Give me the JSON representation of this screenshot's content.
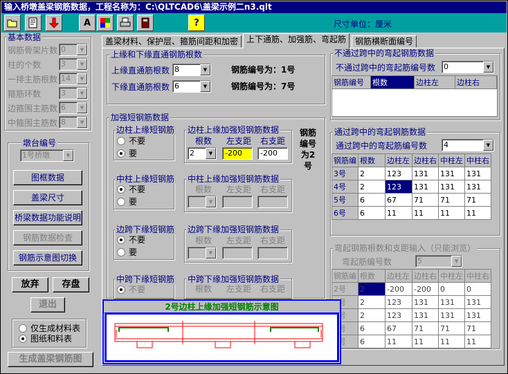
{
  "window": {
    "title": "输入桥墩盖梁钢筋数据，工程名称为：C:\\QLTCAD6\\盖梁示例二n3.qlt"
  },
  "toolbar": {
    "unit_label": "尺寸单位：厘米",
    "buttons": [
      "folder-open-icon",
      "edit-icon",
      "arrow-down-icon",
      "text-icon",
      "color-icon",
      "print-icon",
      "calculator-icon",
      "help-icon"
    ],
    "text_glyph": "A",
    "help_glyph": "?"
  },
  "left": {
    "basic_title": "基本数据",
    "basic_fields": [
      {
        "label": "钢筋骨架片数",
        "value": "0"
      },
      {
        "label": "柱的个数",
        "value": "3"
      },
      {
        "label": "一排主筋根数",
        "value": "14"
      },
      {
        "label": "箍筋环数",
        "value": "3"
      },
      {
        "label": "边箍围主筋数",
        "value": "6"
      },
      {
        "label": "中箍围主筋数",
        "value": "8"
      }
    ],
    "pier_title": "墩台编号",
    "pier_value": "1号桥墩",
    "buttons": [
      "图框数据",
      "盖梁尺寸",
      "桥梁数据功能说明",
      "钢筋数据检查",
      "钢筋示意图切换"
    ],
    "abandon": "放弃",
    "save": "存盘",
    "exit": "退出",
    "output_options": [
      "仅生成材料表",
      "图纸和料表"
    ],
    "generate": "生成盖梁钢筋图"
  },
  "tabs": [
    "盖梁材料、保护层、箍筋间距和加密",
    "上下通筋、加强筋、弯起筋",
    "钢筋横断面编号"
  ],
  "through": {
    "title": "上缘和下缘直通钢筋根数",
    "top_label": "上缘直通筋根数",
    "top_value": "8",
    "top_code": "钢筋编号为：1号",
    "bottom_label": "下缘直通筋根数",
    "bottom_value": "6",
    "bottom_code": "钢筋编号为：7号"
  },
  "reinforce": {
    "title": "加强短钢筋数据",
    "side_code": "钢筋编号为2号",
    "groups": [
      {
        "title": "边柱上缘短钢筋",
        "no": "不要",
        "yes": "要",
        "sel": "yes",
        "data_title": "边柱上缘加强短钢筋数据",
        "count": "2",
        "left": "-200",
        "right": "-200"
      },
      {
        "title": "中柱上缘短钢筋",
        "no": "不要",
        "yes": "要",
        "sel": "no",
        "data_title": "中柱上缘加强短钢筋数据",
        "count": "",
        "left": "",
        "right": ""
      },
      {
        "title": "边跨下缘短钢筋",
        "no": "不要",
        "yes": "要",
        "sel": "no",
        "data_title": "边跨下缘加强短钢筋数据",
        "count": "",
        "left": "",
        "right": ""
      },
      {
        "title": "中跨下缘短钢筋",
        "no": "不要",
        "yes": "要",
        "sel": "no",
        "data_title": "中跨下缘加强短钢筋数据",
        "count": "",
        "left": "",
        "right": ""
      }
    ],
    "col_count": "根数",
    "col_left": "左支距",
    "col_right": "右支距"
  },
  "no_span_bent": {
    "title": "不通过跨中的弯起钢筋数据",
    "count_label": "不通过跨中的弯起筋编号数",
    "count_value": "0",
    "headers": [
      "钢筋编号",
      "根数",
      "边柱左",
      "边柱右"
    ]
  },
  "span_bent": {
    "title": "通过跨中的弯起钢筋数据",
    "count_label": "通过跨中的弯起筋编号数",
    "count_value": "4",
    "headers": [
      "钢筋编",
      "根数",
      "边柱左",
      "边柱右",
      "中柱左",
      "中柱右"
    ],
    "rows": [
      [
        "3号",
        "2",
        "123",
        "131",
        "131",
        "131"
      ],
      [
        "4号",
        "2",
        "123",
        "131",
        "131",
        "131"
      ],
      [
        "5号",
        "6",
        "67",
        "71",
        "71",
        "71"
      ],
      [
        "6号",
        "6",
        "11",
        "11",
        "11",
        "11"
      ]
    ]
  },
  "bent_view": {
    "title": "弯起钢筋根数和支距输入（只能浏览）",
    "count_label": "弯起筋编号数",
    "count_value": "5",
    "headers": [
      "钢筋编",
      "根数",
      "边柱左",
      "边柱右",
      "中柱左",
      "中柱右"
    ],
    "rows": [
      [
        "2号",
        "2",
        "-200",
        "-200",
        "0",
        "0"
      ],
      [
        "3号",
        "2",
        "123",
        "131",
        "131",
        "131"
      ],
      [
        "4号",
        "2",
        "123",
        "131",
        "131",
        "131"
      ],
      [
        "5号",
        "6",
        "67",
        "71",
        "71",
        "71"
      ],
      [
        "6号",
        "6",
        "11",
        "11",
        "11",
        "11"
      ]
    ]
  },
  "diagram": {
    "title": "2号边柱上缘加强短钢筋示意图"
  },
  "colors": {
    "title_bar": "#000080",
    "toolbar": "#00a0a0",
    "accent_blue": "#0000ff",
    "diagram_green": "#008000",
    "diagram_red": "#ff0000"
  }
}
